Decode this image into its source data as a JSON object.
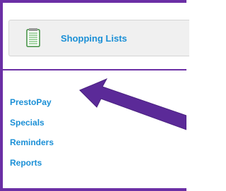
{
  "header": {
    "title": "Shopping Lists",
    "icon": "notepad-list-icon"
  },
  "nav": {
    "items": [
      {
        "label": "PrestoPay"
      },
      {
        "label": "Specials"
      },
      {
        "label": "Reminders"
      },
      {
        "label": "Reports"
      }
    ]
  },
  "annotation": {
    "icon": "arrow-pointer-icon",
    "color": "#6b2fa5"
  },
  "colors": {
    "accent": "#6b2fa5",
    "link": "#1a8fd6"
  }
}
